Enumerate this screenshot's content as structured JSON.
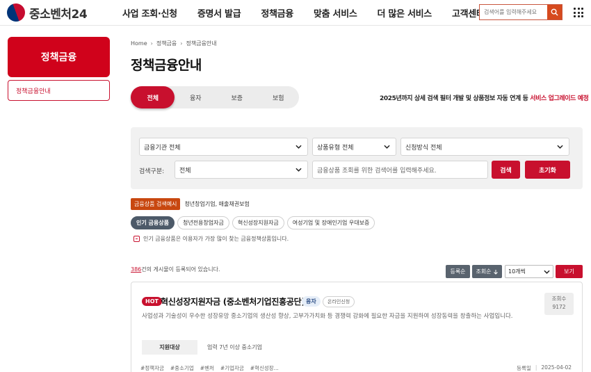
{
  "header": {
    "logo_text": "중소벤처24",
    "nav": [
      "사업 조회·신청",
      "증명서 발급",
      "정책금융",
      "맞춤 서비스",
      "더 많은 서비스",
      "고객센터"
    ],
    "search_placeholder": "검색어를 입력해주세요"
  },
  "sidebar": {
    "title": "정책금융",
    "items": [
      {
        "label": "정책금융안내"
      }
    ]
  },
  "breadcrumb": [
    "Home",
    "정책금융",
    "정책금융안내"
  ],
  "page_title": "정책금융안내",
  "tabs": [
    {
      "label": "전체",
      "active": true
    },
    {
      "label": "융자",
      "active": false
    },
    {
      "label": "보증",
      "active": false
    },
    {
      "label": "보험",
      "active": false
    }
  ],
  "notice": {
    "prefix": "2025년까지 상세 검색 필터 개발 및 상품정보 자동 연계 등 ",
    "highlight": "서비스 업그레이드 예정"
  },
  "filters": {
    "institution": "금융기관 전체",
    "product_type": "상품유형 전체",
    "apply_method": "신청방식 전체",
    "search_label": "검색구분:",
    "search_scope": "전체",
    "search_placeholder": "금융상품 조회를 위한 검색어를 입력해주세요.",
    "search_button": "검색",
    "reset_button": "초기화"
  },
  "example": {
    "badge": "금융상품 검색예시",
    "text": "청년창업기업, 매출채권보험"
  },
  "chips": [
    {
      "label": "인기 금융상품",
      "active": true
    },
    {
      "label": "청년전용창업자금",
      "active": false
    },
    {
      "label": "혁신성장지원자금",
      "active": false
    },
    {
      "label": "여성기업 및 장애인기업 우대보증",
      "active": false
    }
  ],
  "info_text": "인기 금융상품은 이용자가 가장 많이 찾는 금융정책상품입니다.",
  "results": {
    "count": "386",
    "count_suffix": "건의 게시물이 등록되어 있습니다.",
    "sort_reg": "등록순",
    "sort_view": "조회순",
    "per_page": "10개씩",
    "view_button": "보기"
  },
  "card": {
    "hot": "HOT",
    "title": "혁신성장지원자금 (중소벤처기업진흥공단)",
    "type_tag": "융자",
    "online_tag": "온라인신청",
    "view_label": "조회수",
    "view_count": "9172",
    "description": "사업성과 기술성이 우수한 성장유망 중소기업의 생산성 향상, 고부가가치화 등 경쟁력 강화에 필요한 자금을 지원하여 성장동력을 창출하는 사업입니다.",
    "target_label": "지원대상",
    "target_value": "업력 7년 이상 중소기업",
    "hashtags": [
      "#정책자금",
      "#중소기업",
      "#벤처",
      "#기업자금",
      "#혁신성장..."
    ],
    "reg_label": "등록일",
    "reg_date": "2025-04-02"
  },
  "colors": {
    "primary_red": "#c8102e",
    "orange": "#d64a1e",
    "dark_gray": "#59636e"
  }
}
